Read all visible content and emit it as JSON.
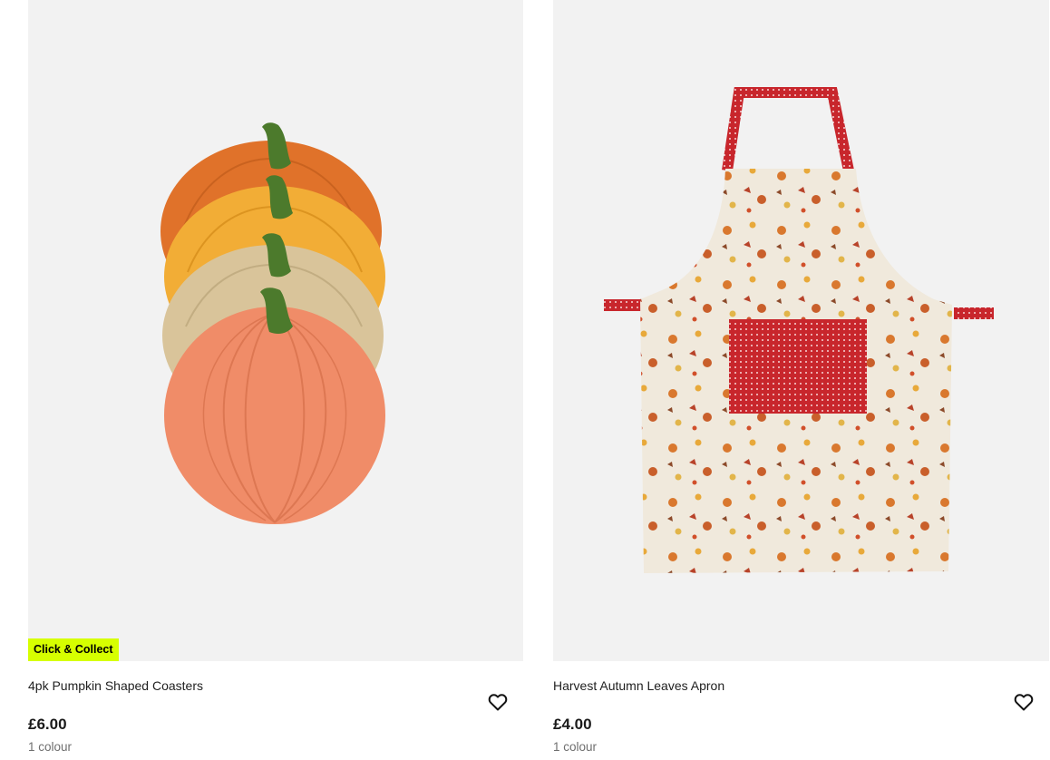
{
  "products": [
    {
      "image_alt": "pumpkin coasters",
      "badge": "Click & Collect",
      "title": "4pk Pumpkin Shaped Coasters",
      "price": "£6.00",
      "colours": "1 colour",
      "wishlist_icon": "heart-outline-icon"
    },
    {
      "image_alt": "autumn apron",
      "badge": "",
      "title": "Harvest Autumn Leaves Apron",
      "price": "£4.00",
      "colours": "1 colour",
      "wishlist_icon": "heart-outline-icon"
    }
  ],
  "colors": {
    "badge_bg": "#d7ff00",
    "image_bg": "#f2f2f2",
    "price": "#1a1a1a",
    "muted": "#6e6e6e"
  }
}
